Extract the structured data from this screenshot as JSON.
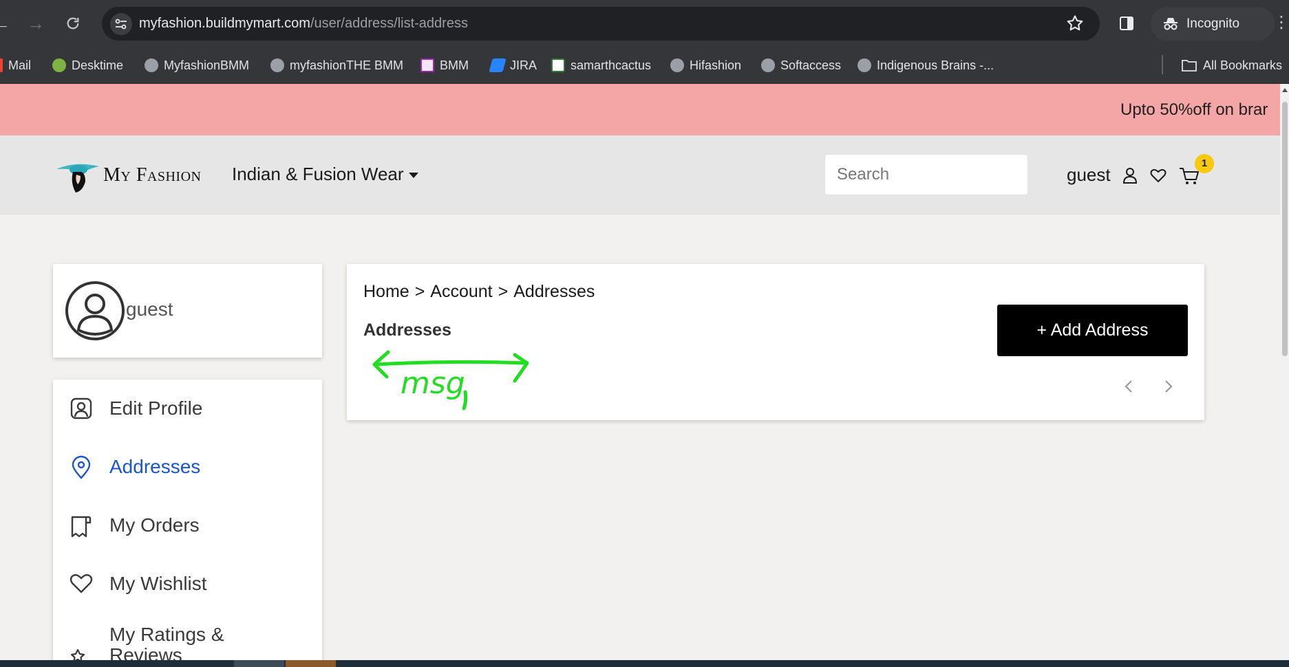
{
  "browser": {
    "url_host": "myfashion.buildmymart.com",
    "url_path": "/user/address/list-address",
    "profile_label": "Incognito",
    "bookmarks": [
      "Mail",
      "Desktime",
      "MyfashionBMM",
      "myfashionTHE BMM",
      "BMM",
      "JIRA",
      "samarthcactus",
      "Hifashion",
      "Softaccess",
      "Indigenous Brains -...",
      "All Bookmarks"
    ]
  },
  "promo": {
    "text": "Upto 50%off on brar"
  },
  "header": {
    "brand": "My Fashion",
    "category_menu": "Indian & Fusion Wear",
    "search_placeholder": "Search",
    "user_name": "guest",
    "cart_count": "1"
  },
  "sidebar": {
    "profile_name": "guest",
    "items": [
      {
        "label": "Edit Profile",
        "icon": "user-square-icon"
      },
      {
        "label": "Addresses",
        "icon": "location-pin-icon",
        "active": true
      },
      {
        "label": "My Orders",
        "icon": "receipt-icon"
      },
      {
        "label": "My Wishlist",
        "icon": "heart-icon"
      },
      {
        "label": "My Ratings & Reviews",
        "icon": "star-list-icon"
      }
    ]
  },
  "main": {
    "breadcrumb": [
      "Home",
      "Account",
      "Addresses"
    ],
    "breadcrumb_sep": ">",
    "section_title": "Addresses",
    "add_button": "+ Add Address"
  },
  "annotation": {
    "text": "msg",
    "color": "#22dd22"
  },
  "colors": {
    "accent": "#1a56c8",
    "promo": "#f4a5a5",
    "badge": "#f6c90e"
  }
}
